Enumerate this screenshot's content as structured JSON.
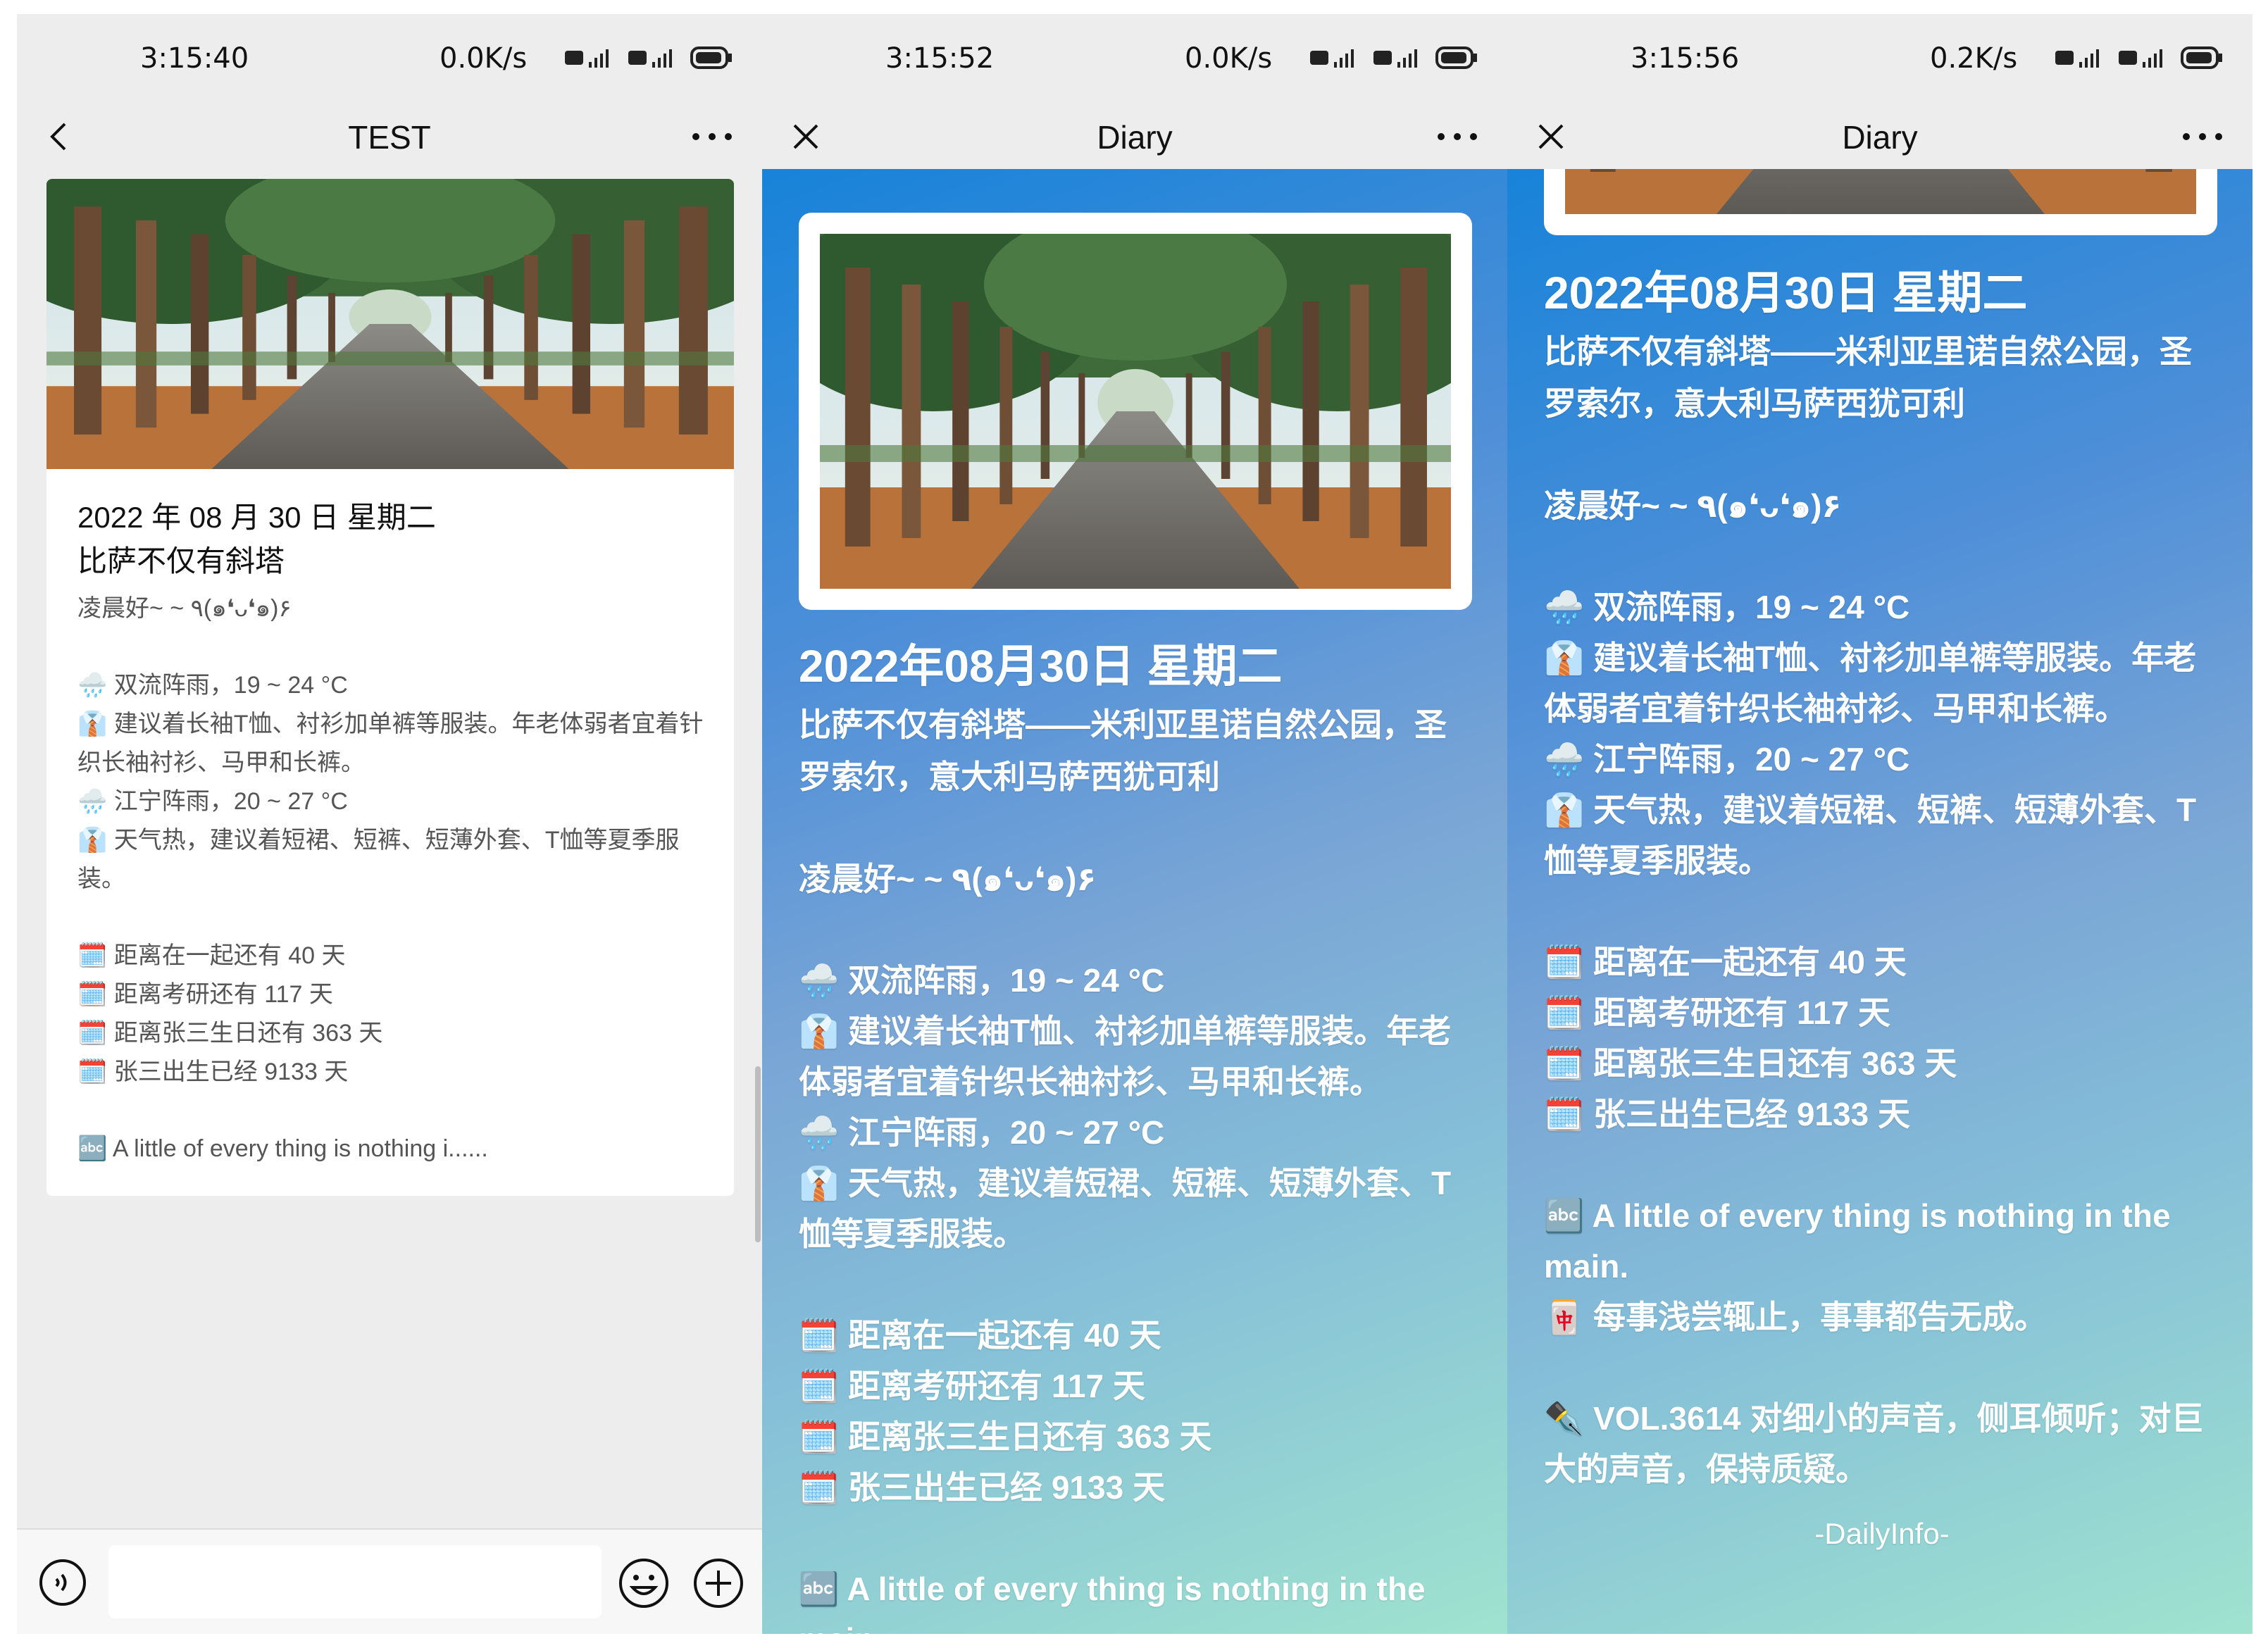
{
  "panels": [
    {
      "status": {
        "time": "3:15:40",
        "net": "0.0K/s"
      },
      "title": "TEST",
      "card": {
        "date": "2022 年 08 月 30 日 星期二",
        "place": "比萨不仅有斜塔",
        "greet": "凌晨好~ ~ ٩(๑❛ᴗ❛๑)۶",
        "weather": [
          "🌧️ 双流阵雨，19 ~ 24 °C",
          "👔 建议着长袖T恤、衬衫加单裤等服装。年老体弱者宜着针织长袖衬衫、马甲和长裤。",
          "🌧️ 江宁阵雨，20 ~ 27 °C",
          "👔 天气热，建议着短裙、短裤、短薄外套、T恤等夏季服装。"
        ],
        "countdown": [
          "🗓️ 距离在一起还有 40 天",
          "🗓️ 距离考研还有 117 天",
          "🗓️ 距离张三生日还有 363 天",
          "🗓️ 张三出生已经 9133 天"
        ],
        "quote": "🔤 A little of every thing is nothing i......"
      }
    },
    {
      "status": {
        "time": "3:15:52",
        "net": "0.0K/s"
      },
      "title": "Diary"
    },
    {
      "status": {
        "time": "3:15:56",
        "net": "0.2K/s"
      },
      "title": "Diary"
    }
  ],
  "diary": {
    "date": "2022年08月30日 星期二",
    "place": "比萨不仅有斜塔——米利亚里诺自然公园，圣罗索尔，意大利马萨西犹可利",
    "greet": "凌晨好~ ~ ٩(๑❛ᴗ❛๑)۶",
    "weather": [
      "🌧️ 双流阵雨，19 ~ 24 °C",
      "👔 建议着长袖T恤、衬衫加单裤等服装。年老体弱者宜着针织长袖衬衫、马甲和长裤。",
      "🌧️ 江宁阵雨，20 ~ 27 °C",
      "👔 天气热，建议着短裙、短裤、短薄外套、T恤等夏季服装。"
    ],
    "countdown": [
      "🗓️ 距离在一起还有 40 天",
      "🗓️ 距离考研还有 117 天",
      "🗓️ 距离张三生日还有 363 天",
      "🗓️ 张三出生已经 9133 天"
    ],
    "quote_en": "🔤 A little of every thing is nothing in the main.",
    "quote_cn": "🀄 每事浅尝辄止，事事都告无成。",
    "vol": "✒️ VOL.3614 对细小的声音，侧耳倾听；对巨大的声音，保持质疑。",
    "sign": "-DailyInfo-"
  },
  "colors": {
    "gradient_start": "#1783d9",
    "gradient_end": "#9fe3cf",
    "chat_bg": "#ededed"
  }
}
